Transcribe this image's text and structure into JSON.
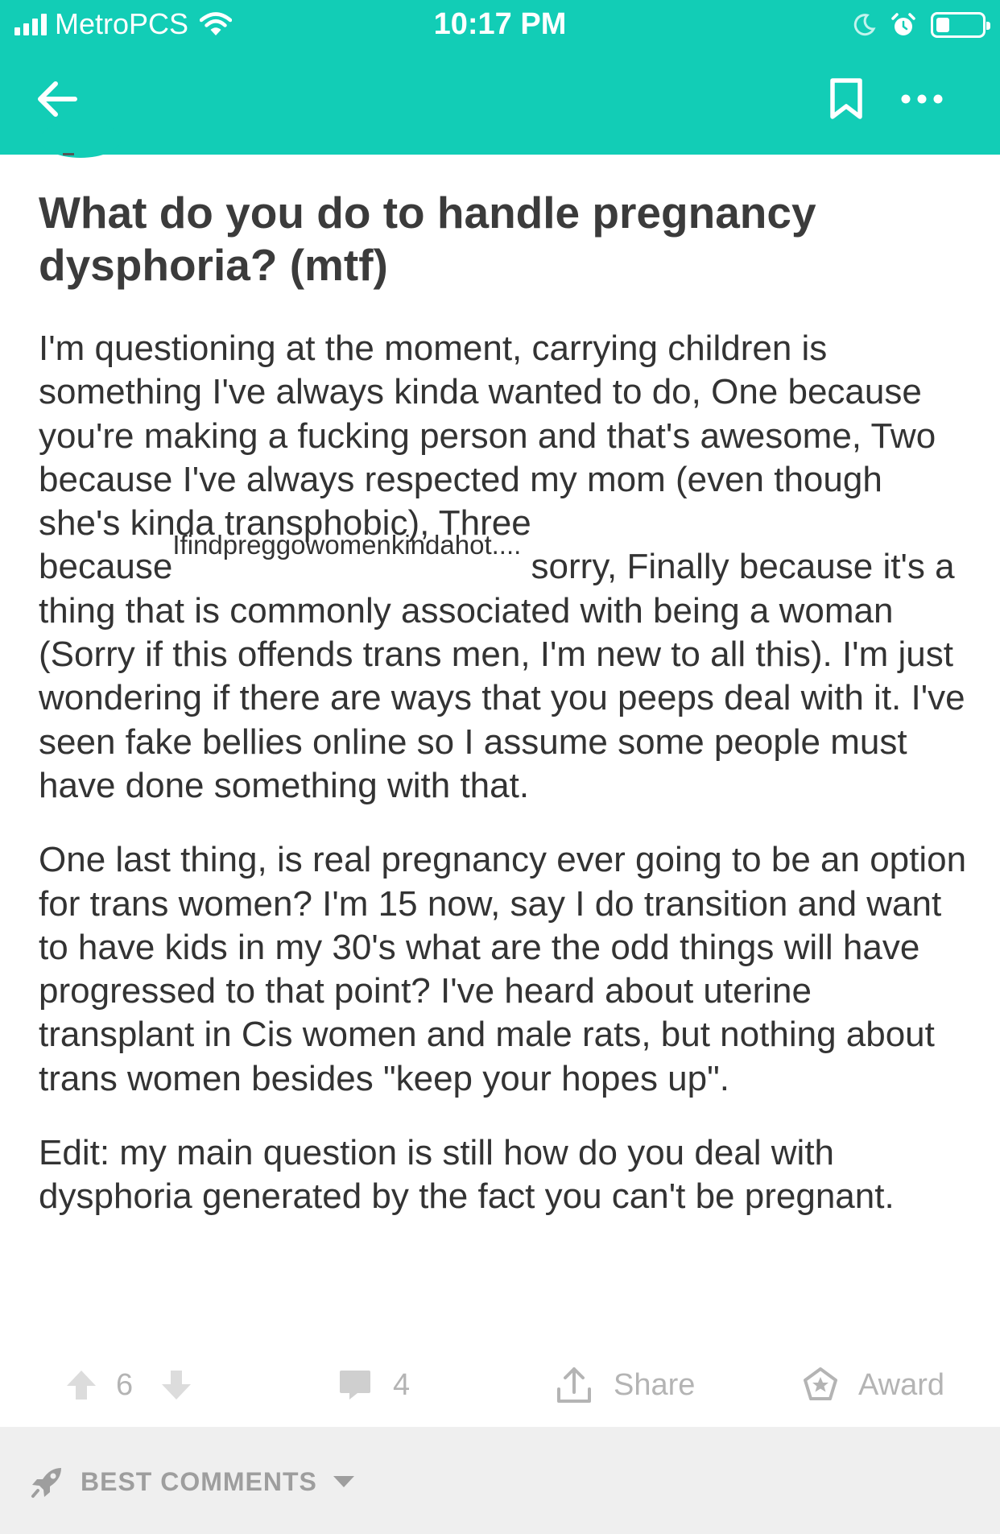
{
  "status_bar": {
    "carrier": "MetroPCS",
    "time": "10:17 PM",
    "battery_level": 0.3
  },
  "nav": {
    "back_icon": "arrow-left-icon",
    "bookmark_icon": "bookmark-icon",
    "more_icon": "more-horizontal-icon"
  },
  "post": {
    "title": "What do you do to handle pregnancy dysphoria? (mtf)",
    "paragraph1_before": "I'm questioning at the moment, carrying children is something I've always kinda wanted to do, One because you're making a fucking person and that's awesome, Two because I've always respected my mom (even though she's kinda transphobic), Three because",
    "paragraph1_superscript": "Ifindpreggowomenkindahot....",
    "paragraph1_after": " sorry, Finally because it's a thing that is commonly associated with being a woman (Sorry if this offends trans men, I'm new to all this). I'm just wondering if there are ways that you peeps deal with it. I've seen fake bellies online so I assume some people must have done something with that.",
    "paragraph2": "One last thing, is real pregnancy ever going to be an option for trans women? I'm 15 now, say I do transition and want to have kids in my 30's what are the odd things will have progressed to that point? I've heard about uterine transplant in Cis women and male rats, but nothing about trans women besides \"keep your hopes up\".",
    "paragraph3": "Edit: my main question is still how do you deal with dysphoria generated by the fact you can't be pregnant."
  },
  "actions": {
    "vote_count": "6",
    "comment_count": "4",
    "share_label": "Share",
    "award_label": "Award"
  },
  "comments": {
    "sort_label": "BEST COMMENTS"
  },
  "colors": {
    "header": "#12cdb6",
    "text": "#333333",
    "muted": "#b4b4b4",
    "comments_bar": "#efefef"
  }
}
